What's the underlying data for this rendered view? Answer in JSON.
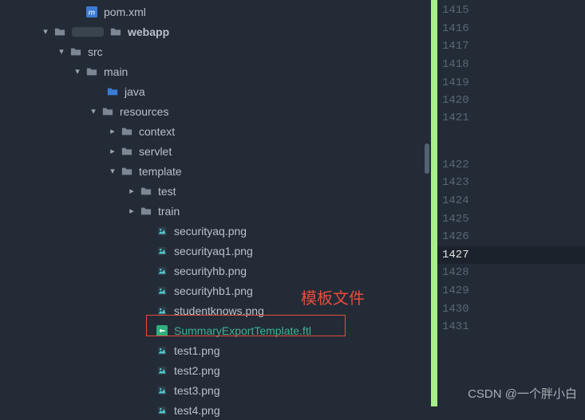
{
  "tree": [
    {
      "indent": 90,
      "chev": "",
      "iconClass": "file-m",
      "label": "pom.xml",
      "bold": false,
      "sel": false,
      "interact": true
    },
    {
      "indent": 50,
      "chev": "down",
      "iconClass": "folder",
      "label": "webapp",
      "bold": true,
      "sel": false,
      "interact": true,
      "prefix": true
    },
    {
      "indent": 70,
      "chev": "down",
      "iconClass": "folder",
      "label": "src",
      "bold": false,
      "sel": false,
      "interact": true
    },
    {
      "indent": 90,
      "chev": "down",
      "iconClass": "folder",
      "label": "main",
      "bold": false,
      "sel": false,
      "interact": true
    },
    {
      "indent": 116,
      "chev": "",
      "iconClass": "folder-blue",
      "label": "java",
      "bold": false,
      "sel": false,
      "interact": true
    },
    {
      "indent": 110,
      "chev": "down",
      "iconClass": "folder",
      "label": "resources",
      "bold": false,
      "sel": false,
      "interact": true,
      "stripeTop": 138
    },
    {
      "indent": 134,
      "chev": "right",
      "iconClass": "folder",
      "label": "context",
      "bold": false,
      "sel": false,
      "interact": true
    },
    {
      "indent": 134,
      "chev": "right",
      "iconClass": "folder",
      "label": "servlet",
      "bold": false,
      "sel": false,
      "interact": true
    },
    {
      "indent": 134,
      "chev": "down",
      "iconClass": "folder",
      "label": "template",
      "bold": false,
      "sel": false,
      "interact": true
    },
    {
      "indent": 158,
      "chev": "right",
      "iconClass": "folder",
      "label": "test",
      "bold": false,
      "sel": false,
      "interact": true
    },
    {
      "indent": 158,
      "chev": "right",
      "iconClass": "folder",
      "label": "train",
      "bold": false,
      "sel": false,
      "interact": true
    },
    {
      "indent": 178,
      "chev": "",
      "iconClass": "file-img",
      "label": "securityaq.png",
      "bold": false,
      "sel": false,
      "interact": true
    },
    {
      "indent": 178,
      "chev": "",
      "iconClass": "file-img",
      "label": "securityaq1.png",
      "bold": false,
      "sel": false,
      "interact": true
    },
    {
      "indent": 178,
      "chev": "",
      "iconClass": "file-img",
      "label": "securityhb.png",
      "bold": false,
      "sel": false,
      "interact": true
    },
    {
      "indent": 178,
      "chev": "",
      "iconClass": "file-img",
      "label": "securityhb1.png",
      "bold": false,
      "sel": false,
      "interact": true
    },
    {
      "indent": 178,
      "chev": "",
      "iconClass": "file-img",
      "label": "studentknows.png",
      "bold": false,
      "sel": false,
      "interact": true
    },
    {
      "indent": 178,
      "chev": "",
      "iconClass": "file-ftl",
      "label": "SummaryExportTemplate.ftl",
      "bold": false,
      "sel": true,
      "interact": true
    },
    {
      "indent": 178,
      "chev": "",
      "iconClass": "file-img",
      "label": "test1.png",
      "bold": false,
      "sel": false,
      "interact": true
    },
    {
      "indent": 178,
      "chev": "",
      "iconClass": "file-img",
      "label": "test2.png",
      "bold": false,
      "sel": false,
      "interact": true
    },
    {
      "indent": 178,
      "chev": "",
      "iconClass": "file-img",
      "label": "test3.png",
      "bold": false,
      "sel": false,
      "interact": true
    },
    {
      "indent": 178,
      "chev": "",
      "iconClass": "file-img",
      "label": "test4.png",
      "bold": false,
      "sel": false,
      "interact": true
    }
  ],
  "annotation": "模板文件",
  "lineNumbers": [
    {
      "n": "1415",
      "active": false,
      "gap": false
    },
    {
      "n": "1416",
      "active": false,
      "gap": false
    },
    {
      "n": "1417",
      "active": false,
      "gap": false
    },
    {
      "n": "1418",
      "active": false,
      "gap": false
    },
    {
      "n": "1419",
      "active": false,
      "gap": false
    },
    {
      "n": "1420",
      "active": false,
      "gap": false
    },
    {
      "n": "1421",
      "active": false,
      "gap": true
    },
    {
      "n": "1422",
      "active": false,
      "gap": false
    },
    {
      "n": "1423",
      "active": false,
      "gap": false
    },
    {
      "n": "1424",
      "active": false,
      "gap": false
    },
    {
      "n": "1425",
      "active": false,
      "gap": false
    },
    {
      "n": "1426",
      "active": false,
      "gap": false
    },
    {
      "n": "1427",
      "active": true,
      "gap": false
    },
    {
      "n": "1428",
      "active": false,
      "gap": false
    },
    {
      "n": "1429",
      "active": false,
      "gap": false
    },
    {
      "n": "1430",
      "active": false,
      "gap": false
    },
    {
      "n": "1431",
      "active": false,
      "gap": false
    }
  ],
  "watermark": "CSDN @一个胖小白"
}
